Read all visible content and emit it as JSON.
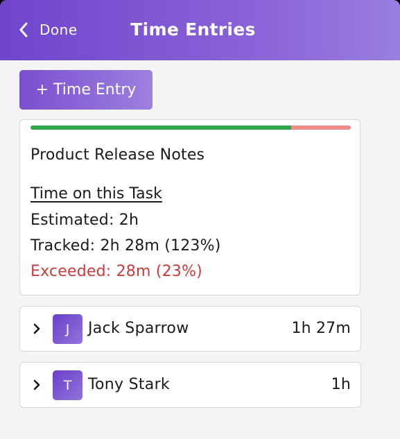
{
  "header": {
    "back_label": "Done",
    "title": "Time Entries"
  },
  "actions": {
    "add_label": "+ Time Entry"
  },
  "task": {
    "name": "Product Release Notes",
    "section_title": "Time on this Task",
    "estimated": "Estimated: 2h",
    "tracked": "Tracked: 2h 28m (123%)",
    "exceeded": "Exceeded: 28m (23%)",
    "progress_fraction": 0.813
  },
  "entries": [
    {
      "initial": "J",
      "name": "Jack Sparrow",
      "time": "1h 27m"
    },
    {
      "initial": "T",
      "name": "Tony Stark",
      "time": "1h"
    }
  ],
  "colors": {
    "brand": "#7a4fcf",
    "tracked_bar": "#2ea84a",
    "exceeded_bar": "#ef8a8a",
    "exceeded_text": "#cc3a3a"
  }
}
